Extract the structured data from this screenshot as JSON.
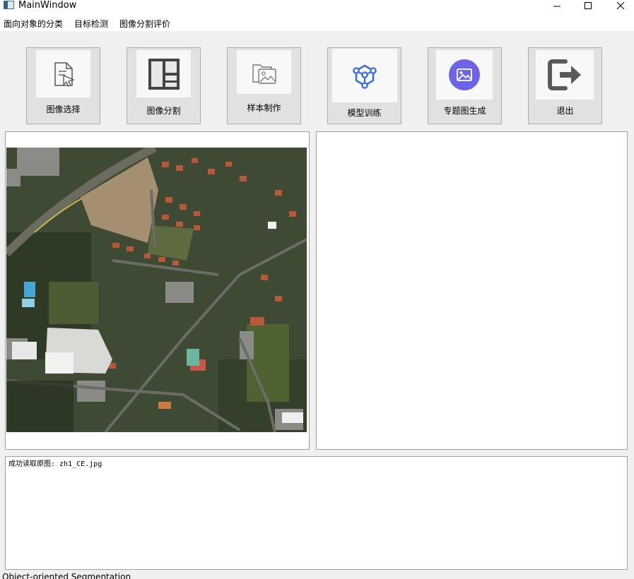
{
  "window": {
    "title": "MainWindow",
    "controls": {
      "minimize_icon": "minimize-icon",
      "maximize_icon": "maximize-icon",
      "close_icon": "close-icon"
    }
  },
  "menu": {
    "items": [
      {
        "label": "面向对象的分类"
      },
      {
        "label": "目标检测"
      },
      {
        "label": "图像分割评价"
      }
    ]
  },
  "toolbar": {
    "buttons": [
      {
        "label": "图像选择",
        "icon": "document-select-icon"
      },
      {
        "label": "图像分割",
        "icon": "grid-segment-icon"
      },
      {
        "label": "样本制作",
        "icon": "image-folder-icon"
      },
      {
        "label": "模型训练",
        "icon": "network-nodes-icon"
      },
      {
        "label": "专题图生成",
        "icon": "image-circle-icon"
      },
      {
        "label": "退出",
        "icon": "exit-icon"
      }
    ],
    "colors": {
      "network_icon": "#3f6fd8",
      "circle_icon": "#6c63e6",
      "exit_icon": "#5a5a5a"
    }
  },
  "log": {
    "text": "成功读取原图: zh1_CE.jpg"
  },
  "status": {
    "text": "Object-oriented Segmentation"
  }
}
